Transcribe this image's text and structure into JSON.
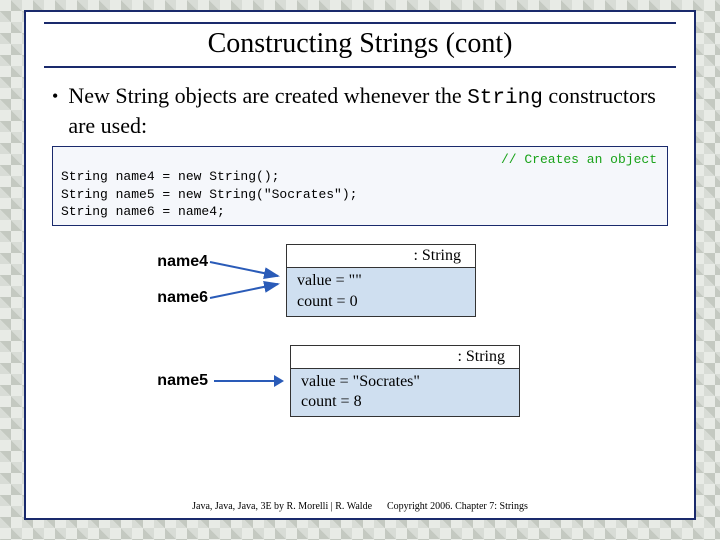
{
  "title": "Constructing Strings (cont)",
  "bullet": {
    "prefix": "New String objects are created whenever the ",
    "mono": "String",
    "suffix": " constructors are used:"
  },
  "code": {
    "line1": "String name4 = new String();",
    "line2": "String name5 = new String(\"Socrates\");",
    "line3": "String name6 = name4;",
    "comment": "// Creates an object"
  },
  "diagram": {
    "label_name4": "name4",
    "label_name6": "name6",
    "label_name5": "name5",
    "obj1_header": ": String",
    "obj1_value": "value = \"\"",
    "obj1_count": "count = 0",
    "obj2_header": ": String",
    "obj2_value": "value = \"Socrates\"",
    "obj2_count": "count = 8"
  },
  "footer": {
    "left": "Java, Java, Java, 3E by R. Morelli | R. Walde",
    "right": "Copyright 2006.  Chapter 7: Strings"
  }
}
